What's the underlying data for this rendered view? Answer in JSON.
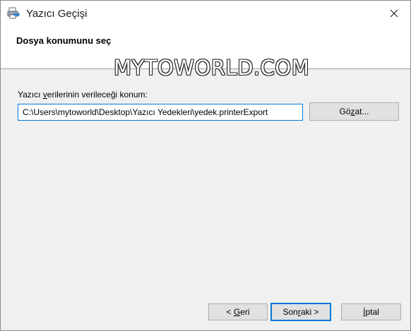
{
  "window": {
    "title": "Yazıcı Geçişi"
  },
  "header": {
    "title": "Dosya konumunu seç"
  },
  "watermark": {
    "text": "MYTOWORLD.COM"
  },
  "location": {
    "label_pre": "Yazıcı ",
    "label_access": "v",
    "label_post": "erilerinin verileceği konum:",
    "path_value": "C:\\Users\\mytoworld\\Desktop\\Yazıcı Yedekleri\\yedek.printerExport",
    "browse_pre": "Gö",
    "browse_access": "z",
    "browse_post": "at..."
  },
  "footer": {
    "back_pre": "< ",
    "back_access": "G",
    "back_post": "eri",
    "next_pre": "Son",
    "next_access": "r",
    "next_post": "aki >",
    "cancel_access": "İ",
    "cancel_post": "ptal"
  },
  "colors": {
    "accent": "#0078d7",
    "dialog_bg": "#f0f0f0",
    "button_bg": "#e1e1e1"
  },
  "icons": {
    "app": "printer-migration-icon",
    "close": "close-icon"
  }
}
